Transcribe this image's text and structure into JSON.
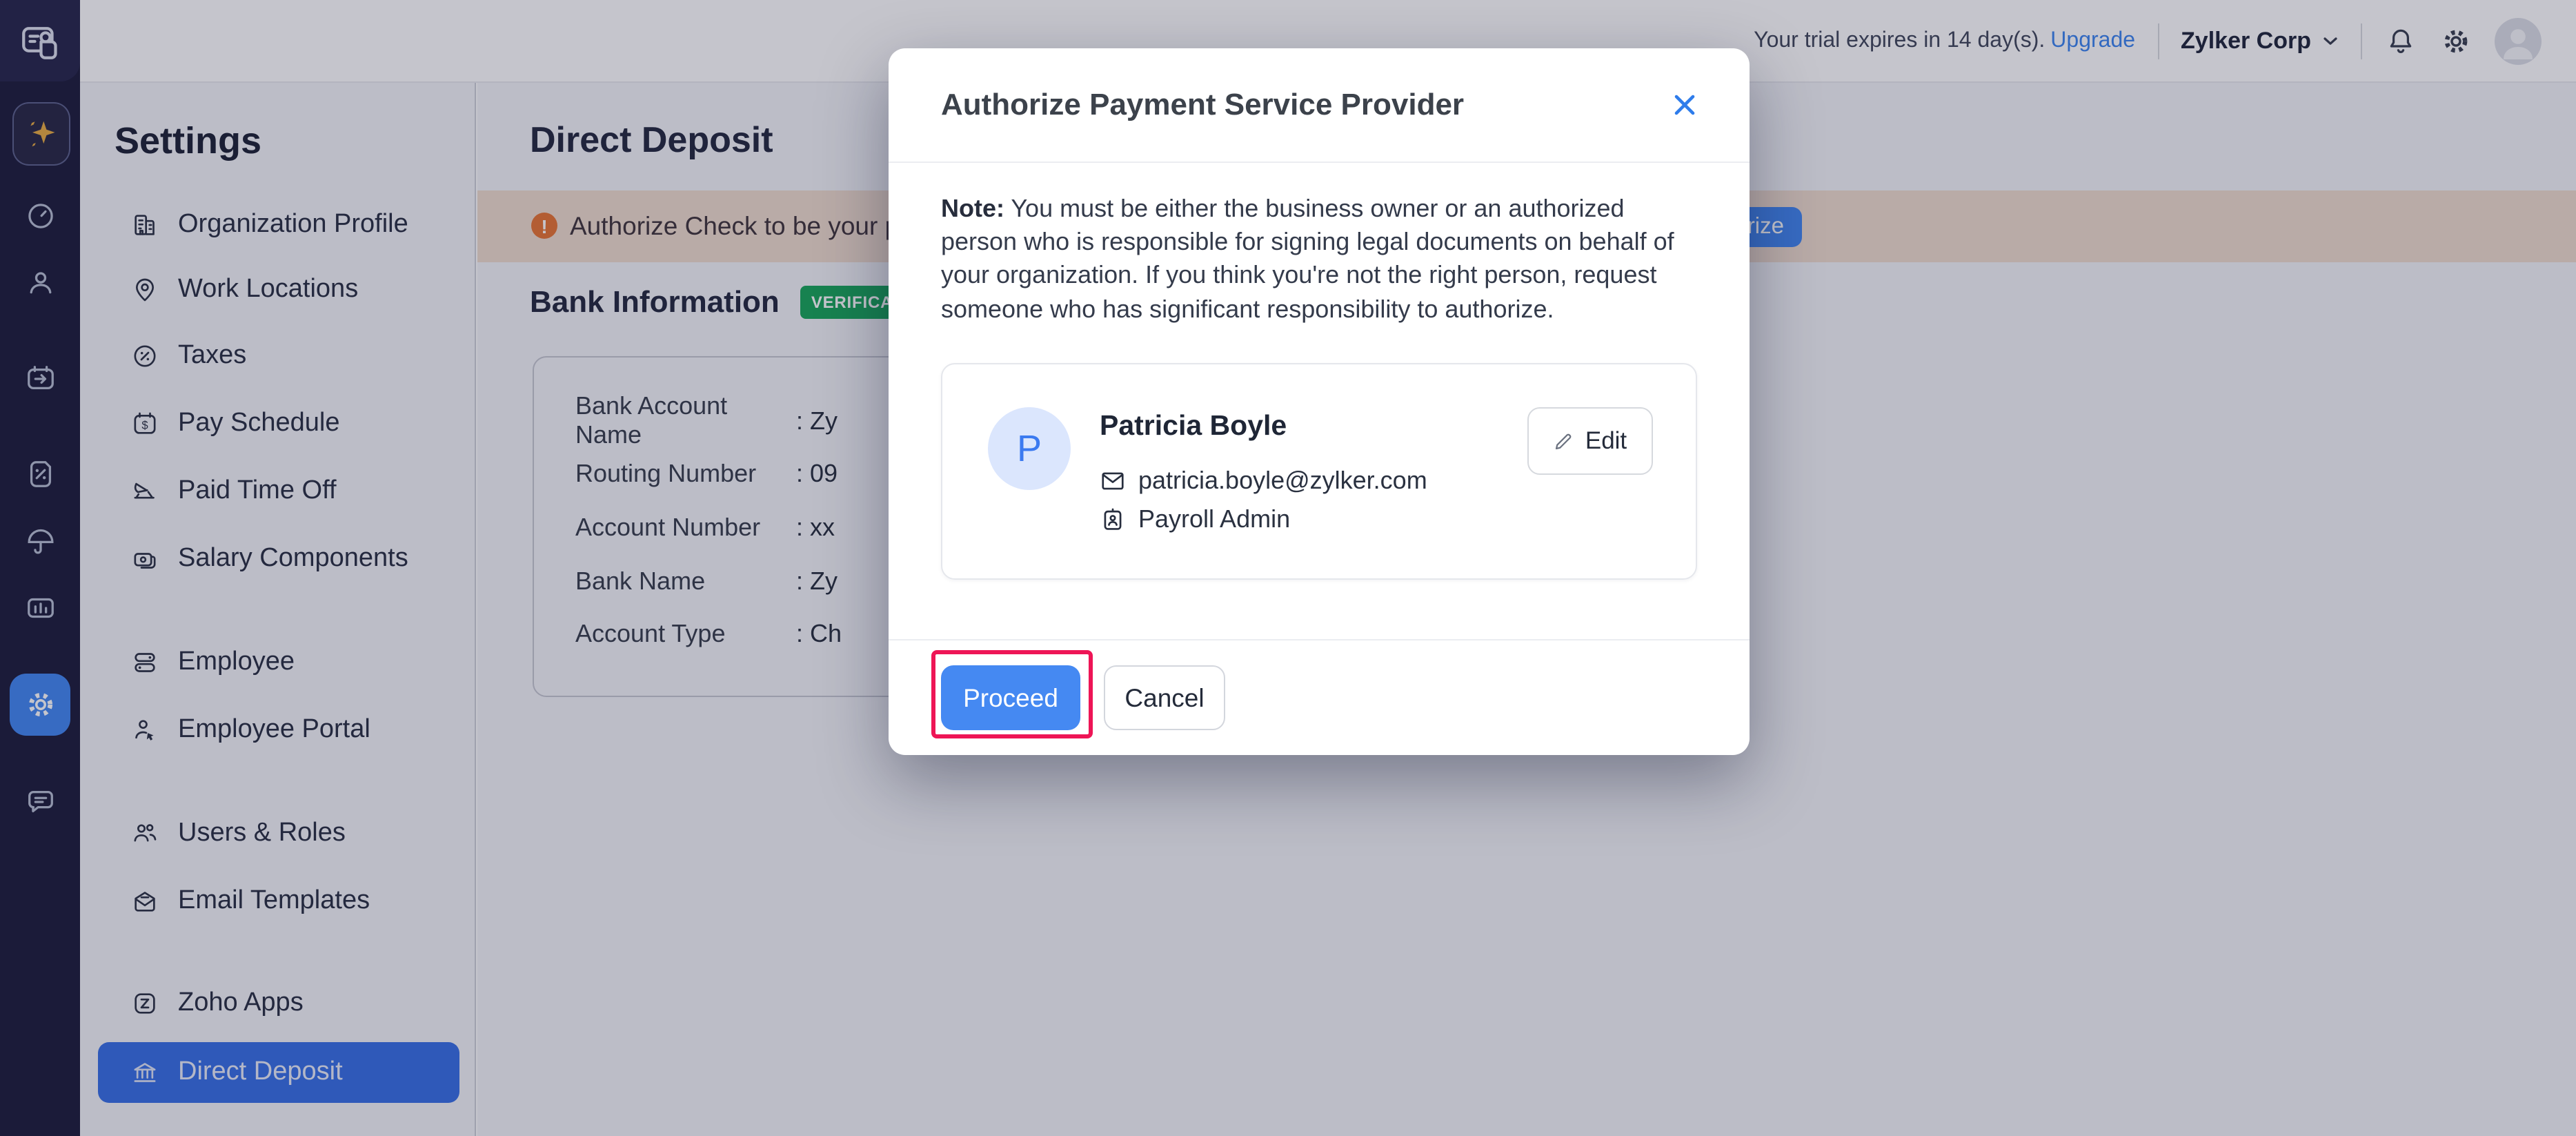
{
  "topbar": {
    "trial_text": "Your trial expires in 14 day(s).",
    "upgrade_label": "Upgrade",
    "org_name": "Zylker Corp"
  },
  "iconbar": {
    "icons": [
      "payroll-logo",
      "ai-sparkle",
      "dashboard",
      "employees",
      "pay-runs",
      "taxes",
      "benefits",
      "reports",
      "settings",
      "chat"
    ]
  },
  "sidebar": {
    "title": "Settings",
    "groups": [
      [
        {
          "label": "Organization Profile"
        },
        {
          "label": "Work Locations"
        },
        {
          "label": "Taxes"
        },
        {
          "label": "Pay Schedule"
        },
        {
          "label": "Paid Time Off"
        },
        {
          "label": "Salary Components"
        }
      ],
      [
        {
          "label": "Employee"
        },
        {
          "label": "Employee Portal"
        }
      ],
      [
        {
          "label": "Users & Roles"
        },
        {
          "label": "Email Templates"
        }
      ],
      [
        {
          "label": "Zoho Apps"
        },
        {
          "label": "Direct Deposit"
        }
      ]
    ],
    "active_item": "Direct Deposit"
  },
  "main": {
    "page_title": "Direct Deposit",
    "banner": {
      "alert_glyph": "!",
      "message": "Authorize Check to be your p",
      "button_label": "rize"
    },
    "bank_section": {
      "heading": "Bank Information",
      "badge": "VERIFICAT"
    },
    "bank_card": {
      "rows": [
        {
          "label": "Bank Account Name",
          "value": ": Zy"
        },
        {
          "label": "Routing Number",
          "value": ": 09"
        },
        {
          "label": "Account Number",
          "value": ": xx"
        },
        {
          "label": "Bank Name",
          "value": ": Zy"
        },
        {
          "label": "Account Type",
          "value": ": Ch"
        }
      ]
    }
  },
  "modal": {
    "title": "Authorize Payment Service Provider",
    "note_label": "Note:",
    "note_text": " You must be either the business owner or an authorized person who is responsible for signing legal documents on behalf of your organization. If you think you're not the right person, request someone who has significant responsibility to authorize.",
    "person": {
      "initial": "P",
      "name": "Patricia Boyle",
      "email": "patricia.boyle@zylker.com",
      "role": "Payroll Admin",
      "edit_label": "Edit"
    },
    "proceed_label": "Proceed",
    "cancel_label": "Cancel"
  },
  "colors": {
    "accent_blue": "#4589f2",
    "badge_green": "#1ba85c",
    "annotation_red": "#ee1556",
    "banner_orange": "#e87736"
  }
}
